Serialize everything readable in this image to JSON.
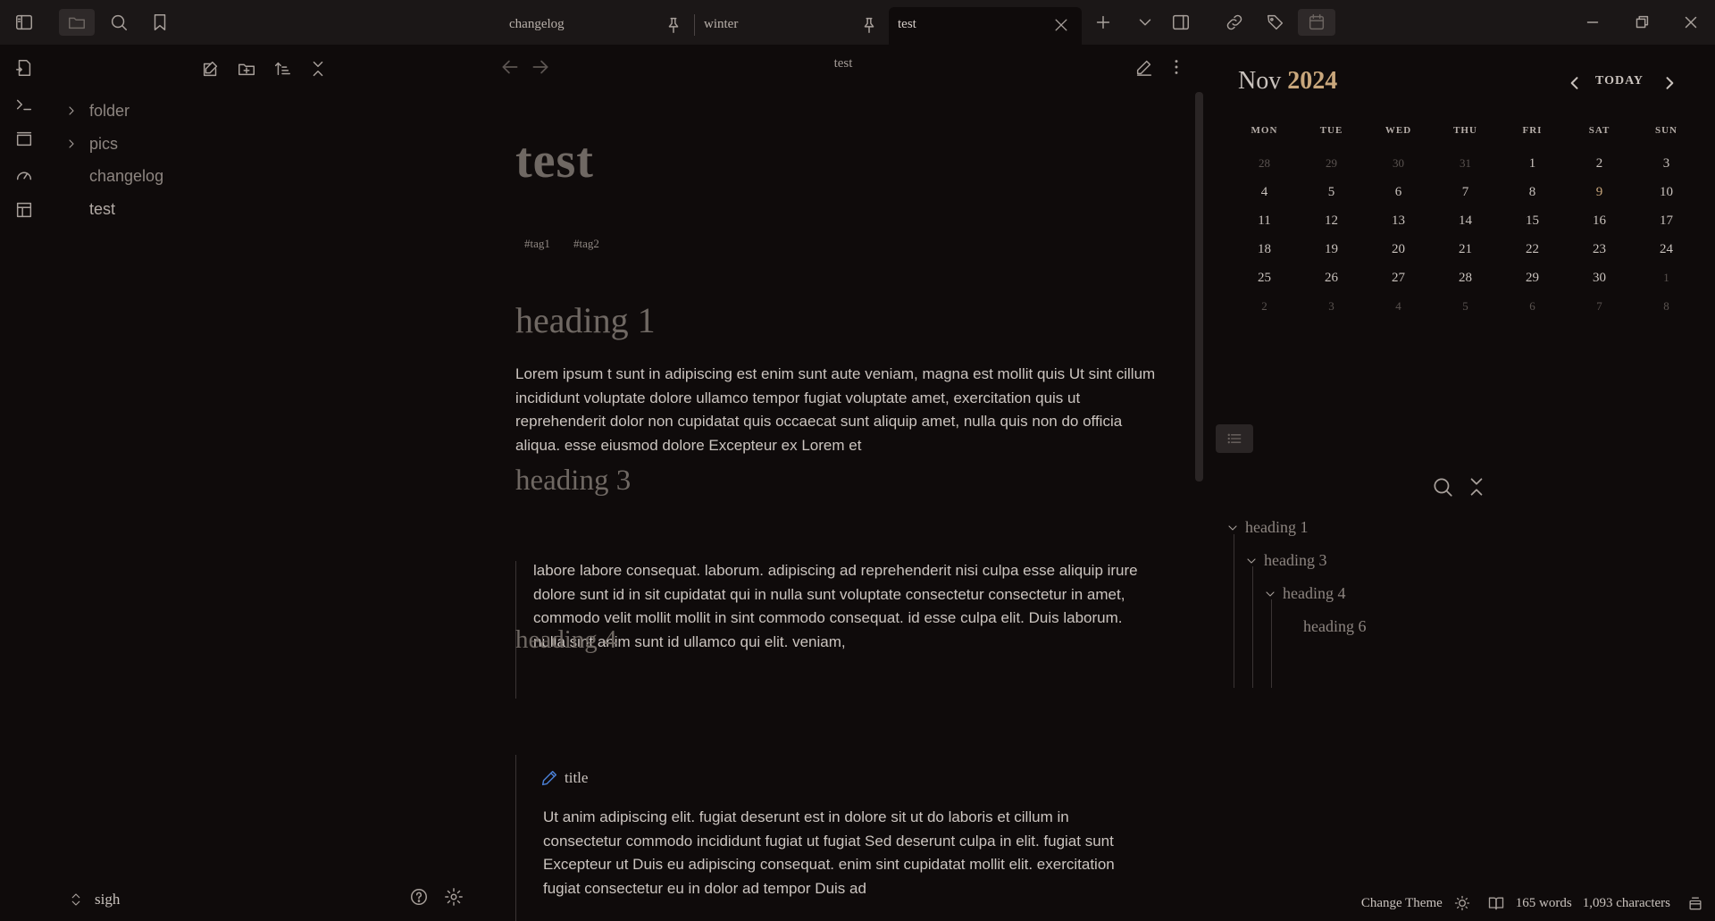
{
  "tabs": [
    {
      "label": "changelog",
      "pinned": true,
      "active": false
    },
    {
      "label": "winter",
      "pinned": true,
      "active": false
    },
    {
      "label": "test",
      "pinned": false,
      "active": true
    }
  ],
  "explorer": {
    "items": [
      {
        "label": "folder",
        "type": "folder"
      },
      {
        "label": "pics",
        "type": "folder"
      },
      {
        "label": "changelog",
        "type": "file"
      },
      {
        "label": "test",
        "type": "file"
      }
    ],
    "vault_name": "sigh"
  },
  "editor": {
    "header_title": "test",
    "title": "test",
    "tags": [
      "#tag1",
      "#tag2"
    ],
    "heading1": "heading 1",
    "para1": "Lorem ipsum t sunt in adipiscing est enim sunt aute veniam, magna est mollit quis Ut sint cillum incididunt voluptate dolore ullamco tempor fugiat voluptate amet, exercitation quis ut reprehenderit dolor non cupidatat quis occaecat sunt aliquip amet, nulla quis non do officia aliqua. esse eiusmod dolore Excepteur ex Lorem et",
    "heading3": "heading 3",
    "para2": "labore labore consequat. laborum. adipiscing ad reprehenderit nisi culpa esse aliquip irure dolore sunt id in sit cupidatat qui in nulla sunt voluptate consectetur consectetur in amet, commodo velit mollit mollit in sint commodo consequat. id esse culpa elit. Duis laborum. nulla sint anim sunt id ullamco qui elit. veniam,",
    "heading4": "heading 4",
    "callout_title": "title",
    "para3": "Ut anim adipiscing elit. fugiat deserunt est in dolore sit ut do laboris et cillum in consectetur commodo incididunt fugiat ut fugiat Sed deserunt culpa in elit. fugiat sunt Excepteur ut Duis eu adipiscing consequat. enim sint cupidatat mollit elit. exercitation fugiat consectetur eu in dolor ad tempor Duis ad"
  },
  "calendar": {
    "month": "Nov",
    "year": "2024",
    "today_label": "TODAY",
    "weekdays": [
      "MON",
      "TUE",
      "WED",
      "THU",
      "FRI",
      "SAT",
      "SUN"
    ],
    "weeks": [
      [
        {
          "d": "28",
          "dim": true
        },
        {
          "d": "29",
          "dim": true
        },
        {
          "d": "30",
          "dim": true
        },
        {
          "d": "31",
          "dim": true
        },
        {
          "d": "1"
        },
        {
          "d": "2"
        },
        {
          "d": "3"
        }
      ],
      [
        {
          "d": "4"
        },
        {
          "d": "5"
        },
        {
          "d": "6"
        },
        {
          "d": "7"
        },
        {
          "d": "8"
        },
        {
          "d": "9",
          "hl": true
        },
        {
          "d": "10"
        }
      ],
      [
        {
          "d": "11"
        },
        {
          "d": "12"
        },
        {
          "d": "13"
        },
        {
          "d": "14"
        },
        {
          "d": "15"
        },
        {
          "d": "16"
        },
        {
          "d": "17"
        }
      ],
      [
        {
          "d": "18"
        },
        {
          "d": "19"
        },
        {
          "d": "20"
        },
        {
          "d": "21"
        },
        {
          "d": "22"
        },
        {
          "d": "23"
        },
        {
          "d": "24"
        }
      ],
      [
        {
          "d": "25"
        },
        {
          "d": "26"
        },
        {
          "d": "27"
        },
        {
          "d": "28"
        },
        {
          "d": "29"
        },
        {
          "d": "30"
        },
        {
          "d": "1",
          "dim": true
        }
      ],
      [
        {
          "d": "2",
          "dim": true
        },
        {
          "d": "3",
          "dim": true
        },
        {
          "d": "4",
          "dim": true
        },
        {
          "d": "5",
          "dim": true
        },
        {
          "d": "6",
          "dim": true
        },
        {
          "d": "7",
          "dim": true
        },
        {
          "d": "8",
          "dim": true
        }
      ]
    ]
  },
  "outline": {
    "items": [
      {
        "label": "heading 1",
        "level": 1,
        "collapsible": true
      },
      {
        "label": "heading 3",
        "level": 2,
        "collapsible": true
      },
      {
        "label": "heading 4",
        "level": 3,
        "collapsible": true
      },
      {
        "label": "heading 6",
        "level": 4,
        "collapsible": false
      }
    ]
  },
  "status": {
    "theme_label": "Change Theme",
    "words": "165 words",
    "characters": "1,093 characters"
  },
  "colors": {
    "accent_gold": "#c9a77c",
    "background": "#0f0b0b",
    "topbar": "#1b1717",
    "callout_icon": "#4a7fd4"
  }
}
